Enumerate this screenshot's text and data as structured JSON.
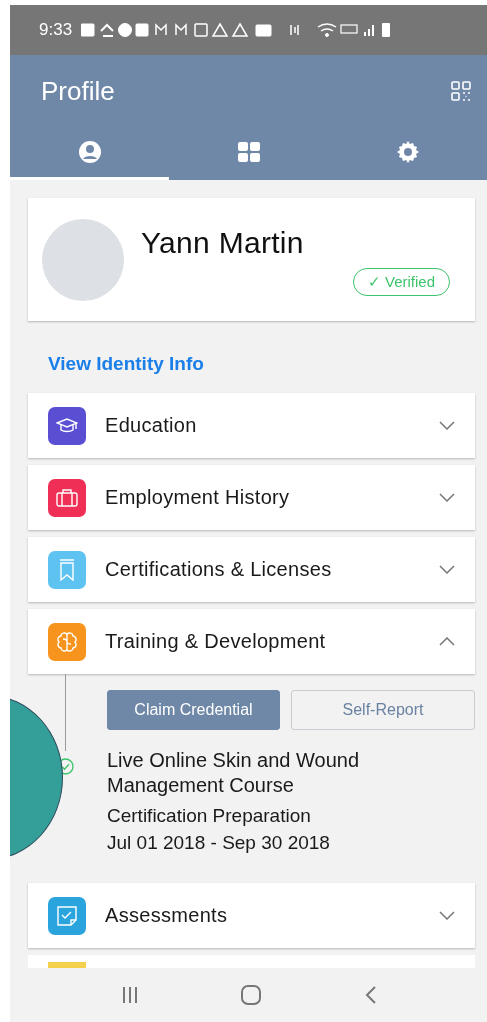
{
  "status_bar": {
    "time": "9:33"
  },
  "header": {
    "title": "Profile"
  },
  "tabs": [
    {
      "selected": true
    },
    {
      "selected": false
    },
    {
      "selected": false
    }
  ],
  "profile": {
    "name": "Yann Martin",
    "badge": "✓ Verified"
  },
  "identity_link": "View Identity Info",
  "sections": [
    {
      "kind": "card",
      "title": "Education",
      "color": "#5a4fd3",
      "expanded": false
    },
    {
      "kind": "card",
      "title": "Employment History",
      "color": "#ef2f55",
      "expanded": false
    },
    {
      "kind": "card",
      "title": "Certifications & Licenses",
      "color": "#5ec3f0",
      "expanded": false
    },
    {
      "kind": "card",
      "title": "Training & Development",
      "color": "#f7941d",
      "expanded": true,
      "buttons": [
        {
          "label": "Claim Credential",
          "kind": "primary"
        },
        {
          "label": "Self-Report",
          "kind": "outline"
        }
      ],
      "entries": [
        {
          "title": "Live Online Skin and Wound Management Course",
          "subtitle": "Certification Preparation",
          "dates": "Jul 01 2018 - Sep 30 2018",
          "completed": true
        }
      ]
    },
    {
      "kind": "card",
      "title": "Assessments",
      "color": "#2aa4dc",
      "expanded": false
    },
    {
      "kind": "partial",
      "color": "#f5d04c"
    }
  ]
}
